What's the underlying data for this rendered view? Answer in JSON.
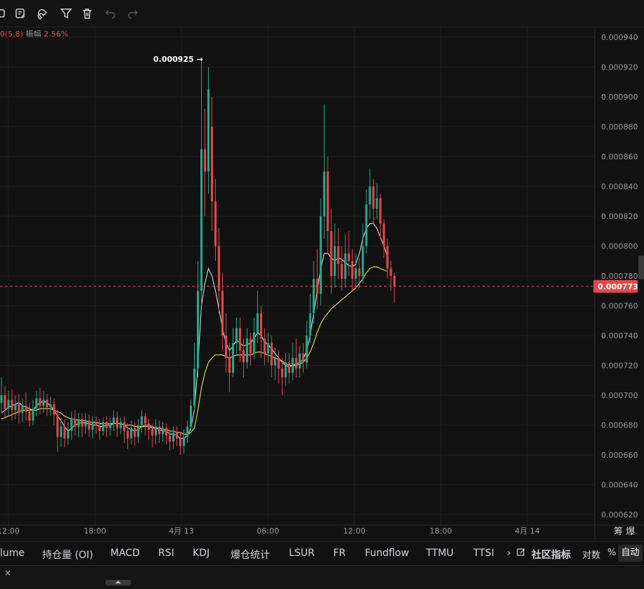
{
  "toolbar": {
    "icons": [
      "drawing-tool-icon",
      "note-icon",
      "magnet-icon",
      "filter-icon",
      "trash-icon",
      "undo-icon",
      "redo-icon"
    ]
  },
  "legend": {
    "ma_suffix": "0(5,8)",
    "amplitude_label": "振幅",
    "amplitude_value": "2.56%"
  },
  "colors": {
    "up": "#2aa58a",
    "down": "#e2484b",
    "ma_fast": "#d6d6d6",
    "ma_slow": "#e6e05a",
    "background": "#111111"
  },
  "chart_data": {
    "type": "candlestick",
    "price_axis_ticks": [
      "0.000940",
      "0.000920",
      "0.000900",
      "0.000880",
      "0.000860",
      "0.000840",
      "0.000820",
      "0.000800",
      "0.000780",
      "0.000760",
      "0.000740",
      "0.000720",
      "0.000700",
      "0.000680",
      "0.000660",
      "0.000640",
      "0.000620"
    ],
    "ylim": [
      0.000614,
      0.000944
    ],
    "time_axis_ticks": [
      "12:00",
      "18:00",
      "4月 13",
      "06:00",
      "12:00",
      "18:00",
      "4月 14"
    ],
    "current_price": "0.000773",
    "high_marker": "0.000925 →",
    "candles": [
      [
        0.000695,
        0.0007,
        0.000712,
        0.000688
      ],
      [
        0.0007,
        0.000691,
        0.000706,
        0.000684
      ],
      [
        0.000691,
        0.000697,
        0.000703,
        0.000686
      ],
      [
        0.000697,
        0.00069,
        0.000704,
        0.000683
      ],
      [
        0.00069,
        0.000694,
        0.0007,
        0.000684
      ],
      [
        0.000694,
        0.000688,
        0.000701,
        0.000681
      ],
      [
        0.000688,
        0.000693,
        0.000698,
        0.000682
      ],
      [
        0.000693,
        0.000689,
        0.000702,
        0.000683
      ],
      [
        0.000689,
        0.000683,
        0.000695,
        0.000679
      ],
      [
        0.000683,
        0.000691,
        0.000697,
        0.00068
      ],
      [
        0.000691,
        0.000698,
        0.000703,
        0.000686
      ],
      [
        0.000698,
        0.000693,
        0.000705,
        0.000687
      ],
      [
        0.000693,
        0.000697,
        0.000703,
        0.000688
      ],
      [
        0.000697,
        0.000692,
        0.000701,
        0.000686
      ],
      [
        0.000692,
        0.000694,
        0.000699,
        0.000686
      ],
      [
        0.000694,
        0.000687,
        0.000698,
        0.00068
      ],
      [
        0.000687,
        0.000672,
        0.00069,
        0.000662
      ],
      [
        0.000672,
        0.000679,
        0.000685,
        0.000665
      ],
      [
        0.000679,
        0.000671,
        0.000684,
        0.000665
      ],
      [
        0.000671,
        0.000676,
        0.000682,
        0.000667
      ],
      [
        0.000676,
        0.000684,
        0.000689,
        0.00067
      ],
      [
        0.000684,
        0.000679,
        0.00069,
        0.000673
      ],
      [
        0.000679,
        0.000684,
        0.000688,
        0.000672
      ],
      [
        0.000684,
        0.000679,
        0.000688,
        0.000672
      ],
      [
        0.000679,
        0.000683,
        0.000688,
        0.000674
      ],
      [
        0.000683,
        0.000677,
        0.000687,
        0.000672
      ],
      [
        0.000677,
        0.000682,
        0.000686,
        0.000671
      ],
      [
        0.000682,
        0.00068,
        0.000686,
        0.000674
      ],
      [
        0.00068,
        0.000676,
        0.000684,
        0.00067
      ],
      [
        0.000676,
        0.000682,
        0.000685,
        0.000673
      ],
      [
        0.000682,
        0.000678,
        0.000686,
        0.000672
      ],
      [
        0.000678,
        0.000681,
        0.000685,
        0.000673
      ],
      [
        0.000681,
        0.000685,
        0.00069,
        0.000676
      ],
      [
        0.000685,
        0.000678,
        0.000689,
        0.000672
      ],
      [
        0.000678,
        0.000682,
        0.000685,
        0.000674
      ],
      [
        0.000682,
        0.000676,
        0.000686,
        0.000668
      ],
      [
        0.000676,
        0.000671,
        0.000681,
        0.000664
      ],
      [
        0.000671,
        0.000678,
        0.000683,
        0.000667
      ],
      [
        0.000678,
        0.000672,
        0.000682,
        0.000666
      ],
      [
        0.000672,
        0.00068,
        0.000684,
        0.000668
      ],
      [
        0.00068,
        0.000686,
        0.00069,
        0.000675
      ],
      [
        0.000686,
        0.000681,
        0.000688,
        0.000673
      ],
      [
        0.000681,
        0.000677,
        0.000684,
        0.00067
      ],
      [
        0.000677,
        0.000673,
        0.000681,
        0.000665
      ],
      [
        0.000673,
        0.000679,
        0.000684,
        0.000667
      ],
      [
        0.000679,
        0.000674,
        0.000683,
        0.000668
      ],
      [
        0.000674,
        0.000678,
        0.000682,
        0.000669
      ],
      [
        0.000678,
        0.000673,
        0.000681,
        0.000667
      ],
      [
        0.000673,
        0.000669,
        0.000677,
        0.000663
      ],
      [
        0.000669,
        0.000675,
        0.000679,
        0.000664
      ],
      [
        0.000675,
        0.000671,
        0.000679,
        0.000666
      ],
      [
        0.000671,
        0.000666,
        0.000675,
        0.00066
      ],
      [
        0.000666,
        0.000672,
        0.000677,
        0.000661
      ],
      [
        0.000672,
        0.000679,
        0.000683,
        0.000668
      ],
      [
        0.000679,
        0.000693,
        0.000697,
        0.000676
      ],
      [
        0.000693,
        0.000718,
        0.000735,
        0.00069
      ],
      [
        0.000718,
        0.00077,
        0.00079,
        0.000712
      ],
      [
        0.00077,
        0.000865,
        0.000925,
        0.00076
      ],
      [
        0.000865,
        0.00085,
        0.000892,
        0.00082
      ],
      [
        0.00085,
        0.000905,
        0.00092,
        0.000835
      ],
      [
        0.00088,
        0.00083,
        0.0009,
        0.00081
      ],
      [
        0.00083,
        0.0008,
        0.000845,
        0.00079
      ],
      [
        0.0008,
        0.00077,
        0.000812,
        0.000755
      ],
      [
        0.00077,
        0.00074,
        0.000782,
        0.00073
      ],
      [
        0.00074,
        0.000725,
        0.000755,
        0.000715
      ],
      [
        0.000725,
        0.000715,
        0.000735,
        0.000702
      ],
      [
        0.000715,
        0.000735,
        0.000745,
        0.000712
      ],
      [
        0.000735,
        0.000745,
        0.000752,
        0.000728
      ],
      [
        0.000745,
        0.00073,
        0.000752,
        0.000722
      ],
      [
        0.00073,
        0.000722,
        0.000738,
        0.000712
      ],
      [
        0.000722,
        0.000738,
        0.000745,
        0.000718
      ],
      [
        0.000738,
        0.000728,
        0.000742,
        0.00072
      ],
      [
        0.000728,
        0.000742,
        0.000752,
        0.000724
      ],
      [
        0.000742,
        0.000755,
        0.00077,
        0.000735
      ],
      [
        0.000755,
        0.000738,
        0.00076,
        0.000725
      ],
      [
        0.000738,
        0.000728,
        0.000745,
        0.00072
      ],
      [
        0.000728,
        0.000735,
        0.000742,
        0.000722
      ],
      [
        0.000735,
        0.00072,
        0.00074,
        0.000712
      ],
      [
        0.00072,
        0.000725,
        0.000732,
        0.00071
      ],
      [
        0.000725,
        0.000718,
        0.00073,
        0.000708
      ],
      [
        0.000718,
        0.000712,
        0.000725,
        0.0007
      ],
      [
        0.000712,
        0.000722,
        0.000728,
        0.000706
      ],
      [
        0.000722,
        0.000715,
        0.000728,
        0.000708
      ],
      [
        0.000715,
        0.000725,
        0.000735,
        0.00071
      ],
      [
        0.000725,
        0.000718,
        0.000738,
        0.000712
      ],
      [
        0.000718,
        0.000728,
        0.000733,
        0.000712
      ],
      [
        0.000728,
        0.000722,
        0.000735,
        0.000715
      ],
      [
        0.000722,
        0.00074,
        0.00075,
        0.000718
      ],
      [
        0.00074,
        0.000755,
        0.000768,
        0.000735
      ],
      [
        0.000755,
        0.000778,
        0.00079,
        0.000748
      ],
      [
        0.000778,
        0.000768,
        0.000798,
        0.000758
      ],
      [
        0.000768,
        0.00082,
        0.000832,
        0.00076
      ],
      [
        0.00082,
        0.00085,
        0.000895,
        0.000805
      ],
      [
        0.00085,
        0.00081,
        0.00086,
        0.000795
      ],
      [
        0.00081,
        0.00078,
        0.000825,
        0.000768
      ],
      [
        0.00078,
        0.0008,
        0.000815,
        0.000772
      ],
      [
        0.0008,
        0.000788,
        0.000812,
        0.000778
      ],
      [
        0.000788,
        0.000778,
        0.0008,
        0.00077
      ],
      [
        0.000778,
        0.000795,
        0.000808,
        0.000772
      ],
      [
        0.000795,
        0.00079,
        0.00081,
        0.00078
      ],
      [
        0.00079,
        0.000778,
        0.000798,
        0.00077
      ],
      [
        0.000778,
        0.000785,
        0.000795,
        0.000772
      ],
      [
        0.000785,
        0.00078,
        0.000792,
        0.000772
      ],
      [
        0.00078,
        0.0008,
        0.000815,
        0.000775
      ],
      [
        0.0008,
        0.000828,
        0.000838,
        0.000795
      ],
      [
        0.000828,
        0.00084,
        0.000852,
        0.000818
      ],
      [
        0.00084,
        0.000825,
        0.000845,
        0.000815
      ],
      [
        0.000825,
        0.000832,
        0.000842,
        0.000818
      ],
      [
        0.000832,
        0.000815,
        0.000835,
        0.000805
      ],
      [
        0.000815,
        0.0008,
        0.000818,
        0.000792
      ],
      [
        0.0008,
        0.000785,
        0.000805,
        0.000778
      ],
      [
        0.000785,
        0.00078,
        0.00079,
        0.00077
      ],
      [
        0.00078,
        0.000773,
        0.000782,
        0.000762
      ]
    ],
    "ma_fast": [
      0.000688,
      0.00069,
      0.000692,
      0.000693,
      0.000694,
      0.000695,
      0.000693,
      0.000692,
      0.000691,
      0.00069,
      0.000693,
      0.000695,
      0.000696,
      0.000695,
      0.000693,
      0.00069,
      0.000686,
      0.000683,
      0.000679,
      0.000676,
      0.000678,
      0.00068,
      0.000681,
      0.000682,
      0.000681,
      0.000681,
      0.00068,
      0.00068,
      0.000679,
      0.000679,
      0.00068,
      0.00068,
      0.000681,
      0.000681,
      0.000681,
      0.00068,
      0.000678,
      0.000677,
      0.000676,
      0.000677,
      0.000679,
      0.00068,
      0.00068,
      0.000679,
      0.000678,
      0.000677,
      0.000676,
      0.000676,
      0.000674,
      0.000674,
      0.000673,
      0.000671,
      0.000671,
      0.000673,
      0.000678,
      0.00069,
      0.00072,
      0.00076,
      0.000775,
      0.000785,
      0.00078,
      0.00077,
      0.000758,
      0.000745,
      0.000735,
      0.00073,
      0.000733,
      0.000737,
      0.000735,
      0.000733,
      0.000734,
      0.000735,
      0.000738,
      0.000742,
      0.00074,
      0.000736,
      0.000734,
      0.000731,
      0.000728,
      0.000725,
      0.000722,
      0.00072,
      0.000719,
      0.00072,
      0.000721,
      0.000722,
      0.000724,
      0.00073,
      0.00074,
      0.000755,
      0.00077,
      0.000785,
      0.000795,
      0.000795,
      0.000792,
      0.00079,
      0.000792,
      0.000791,
      0.000789,
      0.000787,
      0.000786,
      0.000788,
      0.000795,
      0.000805,
      0.000812,
      0.000815,
      0.000815,
      0.000812,
      0.000806,
      0.0008,
      0.000793
    ],
    "ma_slow": [
      0.000684,
      0.000685,
      0.000686,
      0.000687,
      0.000688,
      0.000689,
      0.00069,
      0.00069,
      0.00069,
      0.00069,
      0.00069,
      0.000691,
      0.000691,
      0.000691,
      0.000691,
      0.00069,
      0.000689,
      0.000688,
      0.000686,
      0.000685,
      0.000684,
      0.000684,
      0.000683,
      0.000683,
      0.000683,
      0.000682,
      0.000682,
      0.000682,
      0.000681,
      0.000681,
      0.000681,
      0.000681,
      0.000681,
      0.000681,
      0.000681,
      0.00068,
      0.00068,
      0.00068,
      0.000679,
      0.000679,
      0.000679,
      0.000679,
      0.000679,
      0.000678,
      0.000678,
      0.000678,
      0.000677,
      0.000677,
      0.000676,
      0.000676,
      0.000675,
      0.000675,
      0.000674,
      0.000674,
      0.000675,
      0.000678,
      0.00069,
      0.000705,
      0.000715,
      0.000722,
      0.000725,
      0.000727,
      0.000727,
      0.000727,
      0.000726,
      0.000725,
      0.000726,
      0.000727,
      0.000727,
      0.000727,
      0.000727,
      0.000727,
      0.000728,
      0.000729,
      0.000729,
      0.000728,
      0.000727,
      0.000726,
      0.000725,
      0.000724,
      0.000723,
      0.000721,
      0.00072,
      0.00072,
      0.00072,
      0.000721,
      0.000722,
      0.000725,
      0.000729,
      0.000735,
      0.000742,
      0.000748,
      0.000752,
      0.000755,
      0.000758,
      0.00076,
      0.000762,
      0.000764,
      0.000766,
      0.000768,
      0.00077,
      0.000772,
      0.000775,
      0.000778,
      0.000782,
      0.000785,
      0.000786,
      0.000786,
      0.000785,
      0.000784,
      0.000783
    ]
  },
  "bottom_tabs": [
    "lume",
    "持仓量 (OI)",
    "MACD",
    "RSI",
    "KDJ",
    "爆仓统计",
    "LSUR",
    "FR",
    "Fundflow",
    "TTMU",
    "TTSI",
    "›"
  ],
  "community_label": "社区指标",
  "right_controls": {
    "log_label": "对数",
    "percent_label": "%",
    "auto_label": "自动",
    "axis_corner": "筹 爆"
  },
  "close_label": "×"
}
